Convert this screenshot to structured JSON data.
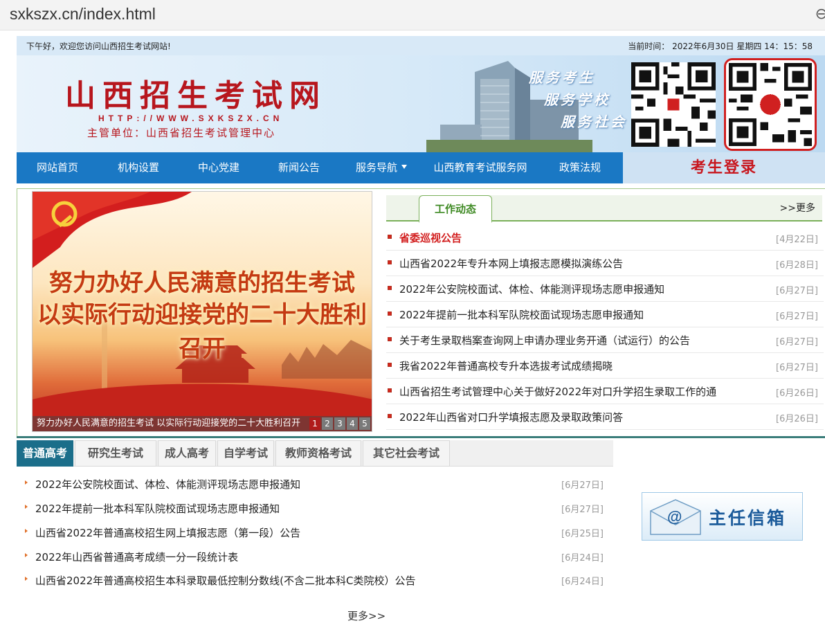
{
  "browser": {
    "url": "sxkszx.cn/index.html",
    "control_icon": "zoom-icon"
  },
  "topbar": {
    "welcome": "下午好，欢迎您访问山西招生考试网站!",
    "time": "当前时间： 2022年6月30日 星期四 14：15：58"
  },
  "banner": {
    "title": "山西招生考试网",
    "url": "HTTP://WWW.SXKSZX.CN",
    "admin": "主管单位：山西省招生考试管理中心",
    "slogans": [
      "服务考生",
      "服务学校",
      "服务社会"
    ],
    "qr_icons": [
      "qr-code-icon",
      "qr-code-icon"
    ]
  },
  "nav": {
    "items": [
      "网站首页",
      "机构设置",
      "中心党建",
      "新闻公告",
      "服务导航",
      "山西教育考试服务网",
      "政策法规"
    ],
    "login": "考生登录"
  },
  "slideshow": {
    "line1": "努力办好人民满意的招生考试",
    "line2": "以实际行动迎接党的二十大胜利召开",
    "caption": "努力办好人民满意的招生考试 以实际行动迎接党的二十大胜利召开",
    "pages": [
      "1",
      "2",
      "3",
      "4",
      "5"
    ],
    "active_page": 1
  },
  "work": {
    "tab": "工作动态",
    "more": ">>更多",
    "items": [
      {
        "title": "省委巡视公告",
        "date": "[4月22日]",
        "hot": true
      },
      {
        "title": "山西省2022年专升本网上填报志愿模拟演练公告",
        "date": "[6月28日]"
      },
      {
        "title": "2022年公安院校面试、体检、体能测评现场志愿申报通知",
        "date": "[6月27日]"
      },
      {
        "title": "2022年提前一批本科军队院校面试现场志愿申报通知",
        "date": "[6月27日]"
      },
      {
        "title": "关于考生录取档案查询网上申请办理业务开通（试运行）的公告",
        "date": "[6月27日]"
      },
      {
        "title": "我省2022年普通高校专升本选拔考试成绩揭晓",
        "date": "[6月27日]"
      },
      {
        "title": "山西省招生考试管理中心关于做好2022年对口升学招生录取工作的通",
        "date": "[6月26日]"
      },
      {
        "title": "2022年山西省对口升学填报志愿及录取政策问答",
        "date": "[6月26日]"
      }
    ]
  },
  "exam": {
    "tabs": [
      "普通高考",
      "研究生考试",
      "成人高考",
      "自学考试",
      "教师资格考试",
      "其它社会考试"
    ],
    "active_tab": 0,
    "items": [
      {
        "title": "2022年公安院校面试、体检、体能测评现场志愿申报通知",
        "date": "[6月27日]"
      },
      {
        "title": "2022年提前一批本科军队院校面试现场志愿申报通知",
        "date": "[6月27日]"
      },
      {
        "title": "山西省2022年普通高校招生网上填报志愿（第一段）公告",
        "date": "[6月25日]"
      },
      {
        "title": "2022年山西省普通高考成绩一分一段统计表",
        "date": "[6月24日]"
      },
      {
        "title": "山西省2022年普通高校招生本科录取最低控制分数线(不含二批本科C类院校）公告",
        "date": "[6月24日]"
      }
    ],
    "more": "更多>>"
  },
  "mailbox": {
    "label": "主任信箱",
    "icon": "mail-at-icon"
  },
  "colors": {
    "brand_red": "#b7161d",
    "nav_blue": "#1a78c4",
    "tab_teal": "#1b6e8a",
    "work_green": "#3f8a24"
  }
}
